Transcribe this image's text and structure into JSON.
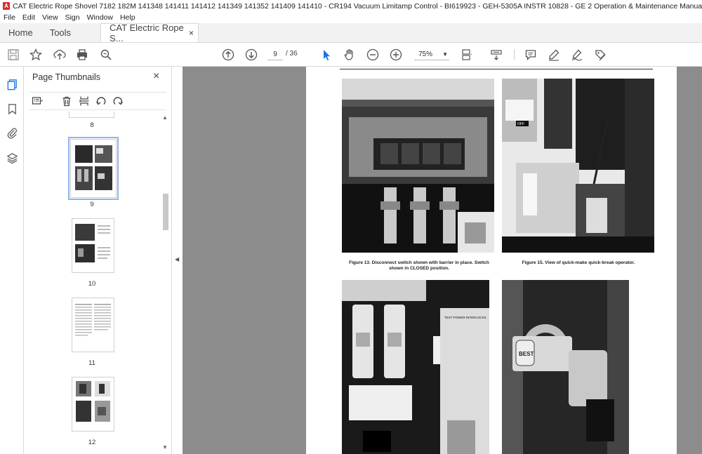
{
  "window": {
    "title": "CAT Electric Rope Shovel 7182 182M 141348 141411 141412 141349 141352 141409 141410 - CR194 Vacuum Limitamp Control - BI619923 - GEH-5305A INSTR 10828 - GE 2 Operation & Maintenance Manuals EN PDF.pdf - Adobe Acrobat Pro DC (32-bit)"
  },
  "menu": [
    "File",
    "Edit",
    "View",
    "Sign",
    "Window",
    "Help"
  ],
  "tabs": {
    "home": "Home",
    "tools": "Tools",
    "document": "CAT Electric Rope S...",
    "close": "×"
  },
  "toolbar": {
    "page_current": "9",
    "page_total": "/ 36",
    "zoom": "75%",
    "colors": {
      "select_active": "#1a73e8",
      "icon": "#555555"
    }
  },
  "panel": {
    "title": "Page Thumbnails",
    "close": "×",
    "thumbnails": [
      {
        "number": "8"
      },
      {
        "number": "9",
        "selected": true
      },
      {
        "number": "10"
      },
      {
        "number": "11"
      },
      {
        "number": "12"
      }
    ]
  },
  "document": {
    "page_number": 9,
    "figure_13": "Figure 13.  Disconnect switch shown with barrier in place. Switch shown in CLOSED position.",
    "figure_15": "Figure 15.  View of quick-make quick-break operator.",
    "label_off": "OFF",
    "label_test_power": "TEST POWER INTERLOCKS",
    "label_lock": "BEST"
  }
}
